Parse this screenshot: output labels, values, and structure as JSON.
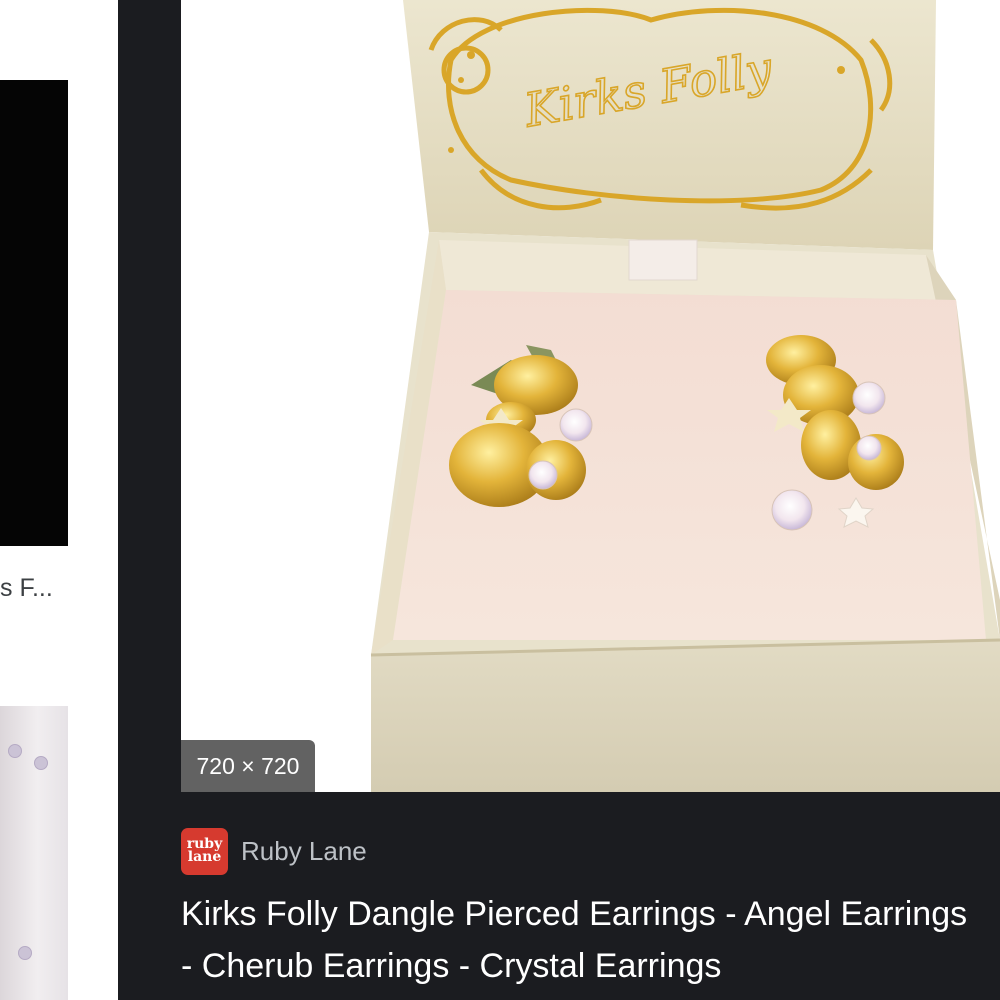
{
  "left_column": {
    "caption": "s F..."
  },
  "preview": {
    "image_alt": "Kirks Folly earrings in gift box",
    "box_brand_script": "Kirks Folly",
    "dimensions_badge": "720 × 720"
  },
  "source": {
    "logo_text": "ruby\nlane",
    "name": "Ruby Lane"
  },
  "result": {
    "title": "Kirks Folly Dangle Pierced Earrings - Angel Earrings - Cherub Earrings - Crystal Earrings"
  },
  "colors": {
    "panel_background": "#1b1c20",
    "source_logo": "#d63a2f",
    "source_name": "#bdc1c6",
    "title": "#ffffff"
  },
  "icons": {
    "source_logo": "ruby-lane-logo-icon"
  }
}
